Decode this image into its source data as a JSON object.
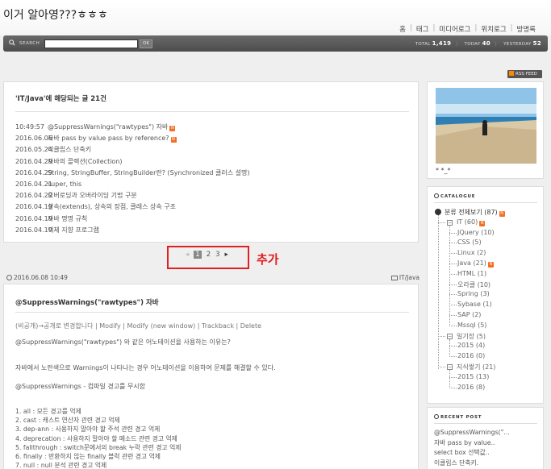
{
  "blog": {
    "title": "이거 알아영???ㅎㅎㅎ"
  },
  "topnav": [
    "홈",
    "태그",
    "미디어로그",
    "위치로그",
    "방명록"
  ],
  "search": {
    "label": "SEARCH",
    "button": "OK",
    "placeholder": ""
  },
  "stats": {
    "total_label": "TOTAL",
    "total": "1,419",
    "today_label": "TODAY",
    "today": "40",
    "yesterday_label": "YESTERDAY",
    "yesterday": "52"
  },
  "rss": "RSS FEED",
  "list": {
    "title": "'IT/Java'에 해당되는 글 21건",
    "items": [
      {
        "date": "10:49:57",
        "title": "@SuppressWarnings(\"rawtypes\") 자바",
        "new": true
      },
      {
        "date": "2016.06.06",
        "title": "자바 pass by value pass by reference?",
        "new": true
      },
      {
        "date": "2016.05.24",
        "title": "이클립스 단축키",
        "new": false
      },
      {
        "date": "2016.04.29",
        "title": "자바의 콜렉션(Collection)",
        "new": false
      },
      {
        "date": "2016.04.29",
        "title": "String, StringBuffer, StringBuilder란? (Synchronized 클러스 설명)",
        "new": false
      },
      {
        "date": "2016.04.21",
        "title": "super, this",
        "new": false
      },
      {
        "date": "2016.04.20",
        "title": "오버로딩과 오버라이딩 기법 구분",
        "new": false
      },
      {
        "date": "2016.04.19",
        "title": "상속(extends), 상속의 장점, 클래스 상속 구조",
        "new": false
      },
      {
        "date": "2016.04.19",
        "title": "자바 명명 규칙",
        "new": false
      },
      {
        "date": "2016.04.19",
        "title": "객체 지향 프로그램",
        "new": false
      }
    ],
    "new_badge": "N"
  },
  "pager": {
    "prev": "◂",
    "pages": [
      "1",
      "2",
      "3"
    ],
    "current": "1",
    "next": "▸"
  },
  "annotation": "추가",
  "post": {
    "meta": "2016.06.08 10:49",
    "category": "IT/Java",
    "title": "@SuppressWarnings(\"rawtypes\") 자바",
    "actions": "(비공개)→공개로 변경합니다 | Modify | Modify (new window) | Trackback | Delete",
    "para1": "@SuppressWarnings(\"rawtypes\") 와 같은 어노테이션을 사용하는 이유는?",
    "para2": "자바에서 노란색으로 Warnings이 나타나는 경우 어노테이션을 이용하여 문제를 해결할 수 있다.",
    "para3": "@SuppressWarnings - 컴파일 경고를 무시함",
    "rules": [
      "1. all : 모든 경고를 억제",
      "2. cast : 캐스트 연산자 관련 경고 억제",
      "3. dep-ann : 사용하지 말아야 할 주석 관련 경고 억제",
      "4. deprecation : 사용하지 말아야 할 메소드 관련 경고 억제",
      "5. fallthrough : switch문에서의 break 누락 관련 경고 억제",
      "6. finally : 반환하지 않는 finally 블럭 관련 경고 억제",
      "7. null : null 분석 관련 경고 억제"
    ]
  },
  "sidebar": {
    "photo_caption": "* *_*",
    "catalogue_title": "CATALOGUE",
    "tree": [
      {
        "label": "분류 전체보기 (87)",
        "new": true
      },
      {
        "label": "IT (60)",
        "new": true
      },
      {
        "label": "JQuery (10)",
        "new": false
      },
      {
        "label": "CSS (5)",
        "new": false
      },
      {
        "label": "Linux (2)",
        "new": false
      },
      {
        "label": "Java (21)",
        "new": true
      },
      {
        "label": "HTML (1)",
        "new": false
      },
      {
        "label": "오라클 (10)",
        "new": false
      },
      {
        "label": "Spring (3)",
        "new": false
      },
      {
        "label": "Sybase (1)",
        "new": false
      },
      {
        "label": "SAP (2)",
        "new": false
      },
      {
        "label": "Mssql (5)",
        "new": false
      },
      {
        "label": "일기장 (5)",
        "new": false
      },
      {
        "label": "2015 (4)",
        "new": false
      },
      {
        "label": "2016 (0)",
        "new": false
      },
      {
        "label": "지식쌓기 (21)",
        "new": false
      },
      {
        "label": "2015 (13)",
        "new": false
      },
      {
        "label": "2016 (8)",
        "new": false
      }
    ],
    "recent_title": "RECENT POST",
    "recent": [
      "@SuppressWarnings(\"...",
      "자바 pass by value..",
      "select box 선택값..",
      "이클립스 단축키."
    ]
  },
  "colors": {
    "accent_red": "#e02020",
    "badge": "#f36f21",
    "bar": "#555555"
  }
}
